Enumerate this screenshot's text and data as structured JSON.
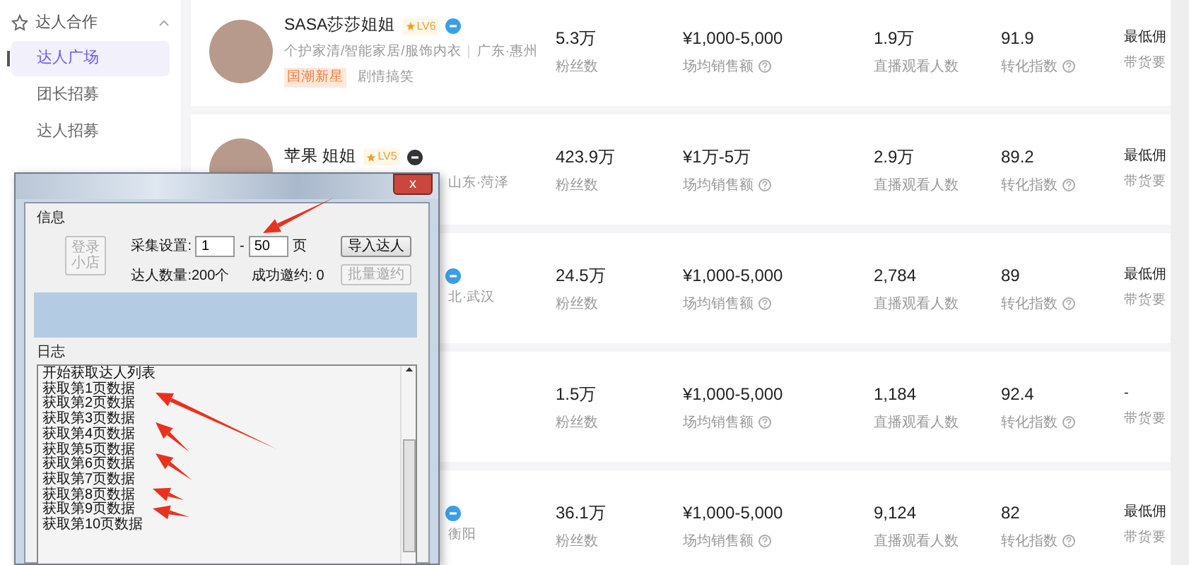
{
  "sidebar": {
    "section": {
      "label": "达人合作",
      "expanded": true
    },
    "items": [
      {
        "label": "达人广场",
        "selected": true
      },
      {
        "label": "团长招募",
        "selected": false
      },
      {
        "label": "达人招募",
        "selected": false
      }
    ]
  },
  "creators": [
    {
      "name": "SASA莎莎姐姐",
      "level": "LV6",
      "color": "#3b9ee8",
      "categories": "个护家清/智能家居/服饰内衣",
      "location": "广东·惠州",
      "tags": [
        {
          "label": "国潮新星",
          "kind": "highlight"
        },
        {
          "label": "剧情搞笑",
          "kind": "plain"
        }
      ],
      "stats": [
        {
          "value": "5.3万",
          "label": "粉丝数",
          "help": false
        },
        {
          "value": "¥1,000-5,000",
          "label": "场均销售额",
          "help": true
        },
        {
          "value": "1.9万",
          "label": "直播观看人数",
          "help": false
        },
        {
          "value": "91.9",
          "label": "转化指数",
          "help": true
        },
        {
          "value": "最低佣",
          "label": "带货要"
        }
      ]
    },
    {
      "name": "苹果 姐姐",
      "level": "LV5",
      "color": "#333333",
      "location": "山东·菏泽",
      "stats": [
        {
          "value": "423.9万",
          "label": "粉丝数",
          "help": false
        },
        {
          "value": "¥1万-5万",
          "label": "场均销售额",
          "help": true
        },
        {
          "value": "2.9万",
          "label": "直播观看人数",
          "help": false
        },
        {
          "value": "89.2",
          "label": "转化指数",
          "help": true
        },
        {
          "value": "最低佣",
          "label": "带货要"
        }
      ]
    },
    {
      "color": "#3b9ee8",
      "location": "北·武汉",
      "stats": [
        {
          "value": "24.5万",
          "label": "粉丝数",
          "help": false
        },
        {
          "value": "¥1,000-5,000",
          "label": "场均销售额",
          "help": true
        },
        {
          "value": "2,784",
          "label": "直播观看人数",
          "help": false
        },
        {
          "value": "89",
          "label": "转化指数",
          "help": true
        },
        {
          "value": "最低佣",
          "label": "带货要"
        }
      ]
    },
    {
      "stats": [
        {
          "value": "1.5万",
          "label": "粉丝数",
          "help": false
        },
        {
          "value": "¥1,000-5,000",
          "label": "场均销售额",
          "help": true
        },
        {
          "value": "1,184",
          "label": "直播观看人数",
          "help": false
        },
        {
          "value": "92.4",
          "label": "转化指数",
          "help": true
        },
        {
          "value": "-",
          "label": "带货要"
        }
      ]
    },
    {
      "color": "#3b9ee8",
      "location": "衡阳",
      "stats": [
        {
          "value": "36.1万",
          "label": "粉丝数",
          "help": false
        },
        {
          "value": "¥1,000-5,000",
          "label": "场均销售额",
          "help": true
        },
        {
          "value": "9,124",
          "label": "直播观看人数",
          "help": false
        },
        {
          "value": "82",
          "label": "转化指数",
          "help": true
        },
        {
          "value": "最低佣",
          "label": "带货要"
        }
      ]
    }
  ],
  "tool_window": {
    "close_button": "x",
    "info_group": "信息",
    "login_button": {
      "lines": [
        "登录",
        "小店"
      ],
      "disabled": true
    },
    "collect_label": "采集设置:",
    "page_from": "1",
    "dash": "-",
    "page_to": "50",
    "page_unit": "页",
    "import_button": {
      "label": "导入达人",
      "disabled": false
    },
    "count_text": "达人数量:200个",
    "invited_text": "成功邀约: 0",
    "batch_button": {
      "label": "批量邀约",
      "disabled": true
    },
    "log_group": "日志",
    "log_lines": [
      "开始获取达人列表",
      "获取第1页数据",
      "获取第2页数据",
      "获取第3页数据",
      "获取第4页数据",
      "获取第5页数据",
      "获取第6页数据",
      "获取第7页数据",
      "获取第8页数据",
      "获取第9页数据",
      "获取第10页数据"
    ]
  }
}
